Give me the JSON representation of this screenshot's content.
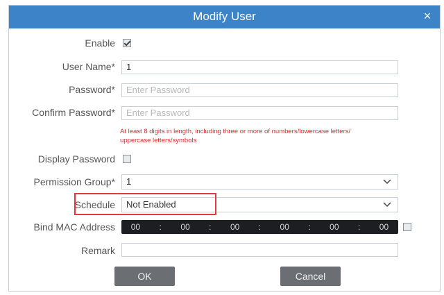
{
  "dialog": {
    "title": "Modify User",
    "close_glyph": "×"
  },
  "fields": {
    "enable_label": "Enable",
    "enable_checked": true,
    "username_label": "User Name*",
    "username_value": "1",
    "password_label": "Password*",
    "password_placeholder": "Enter Password",
    "confirm_label": "Confirm Password*",
    "confirm_placeholder": "Enter Password",
    "password_hint_line1": "At least 8 digits in length, including three or more of numbers/lowercase letters/",
    "password_hint_line2": "uppercase letters/symbols",
    "display_password_label": "Display Password",
    "display_password_checked": false,
    "permission_label": "Permission Group*",
    "permission_value": "1",
    "schedule_label": "Schedule",
    "schedule_value": "Not Enabled",
    "mac_label": "Bind MAC Address",
    "mac_octets": [
      "00",
      "00",
      "00",
      "00",
      "00",
      "00"
    ],
    "mac_separator": ":",
    "mac_checked": false,
    "remark_label": "Remark",
    "remark_value": ""
  },
  "buttons": {
    "ok_label": "OK",
    "cancel_label": "Cancel"
  },
  "colors": {
    "titlebar": "#3c84c7",
    "hint_text": "#e02a2a",
    "highlight_box": "#e23a3a",
    "button_bg": "#6b6e73",
    "mac_bg": "#1c1e22"
  },
  "icons": {
    "close": "close-icon",
    "dropdown": "chevron-down-icon"
  }
}
